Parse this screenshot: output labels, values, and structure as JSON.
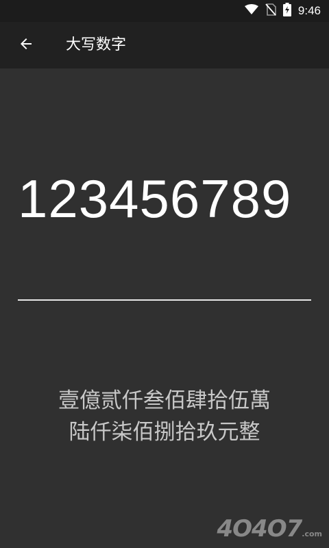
{
  "status_bar": {
    "time": "9:46",
    "icons": [
      "wifi-icon",
      "no-sim-icon",
      "battery-charging-icon"
    ]
  },
  "app_bar": {
    "back_icon": "arrow-back-icon",
    "title": "大写数字"
  },
  "input": {
    "value": "123456789"
  },
  "result": {
    "line1": "壹億贰仟叁佰肆拾伍萬",
    "line2": "陆仟柒佰捌拾玖元整"
  },
  "watermark": {
    "text": "4O4O7",
    "suffix": ".com"
  },
  "colors": {
    "background": "#303030",
    "app_bar": "#212121",
    "status_bar": "#1c1c1c",
    "text_primary": "#ffffff",
    "text_result": "#c8c8c8"
  }
}
